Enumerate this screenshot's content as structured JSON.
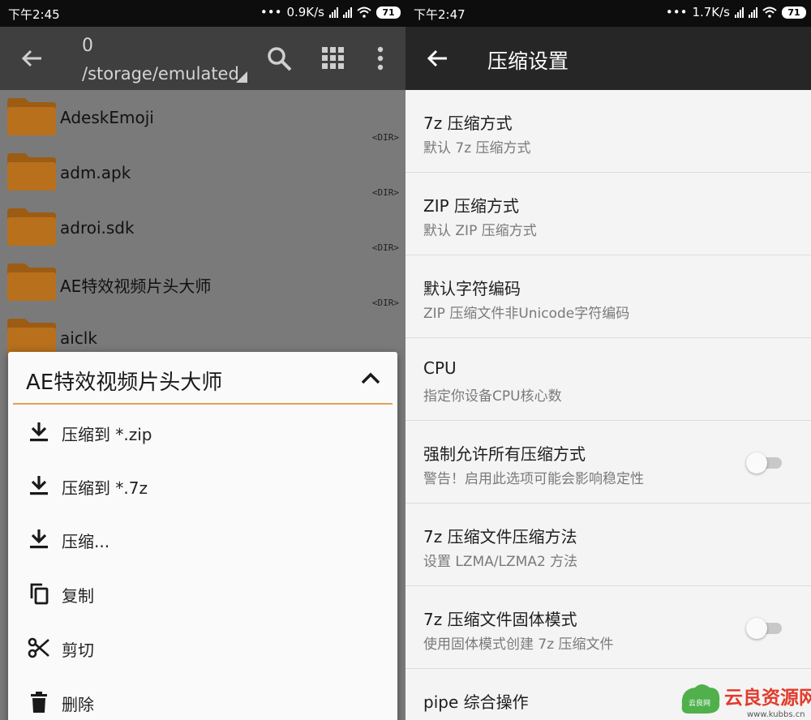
{
  "left": {
    "status": {
      "time": "下午2:45",
      "speed": "0.9K/s",
      "battery": "71"
    },
    "toolbar": {
      "count": "0",
      "path": "/storage/emulated"
    },
    "files": [
      {
        "name": "AdeskEmoji",
        "tag": "<DIR>"
      },
      {
        "name": "adm.apk",
        "tag": "<DIR>"
      },
      {
        "name": "adroi.sdk",
        "tag": "<DIR>"
      },
      {
        "name": "AE特效视频片头大师",
        "tag": "<DIR>"
      },
      {
        "name": "aiclk",
        "tag": ""
      }
    ],
    "menu": {
      "title": "AE特效视频片头大师",
      "items": [
        {
          "label": "压缩到 *.zip",
          "icon": "download-icon"
        },
        {
          "label": "压缩到 *.7z",
          "icon": "download-icon"
        },
        {
          "label": "压缩...",
          "icon": "download-icon"
        },
        {
          "label": "复制",
          "icon": "copy-icon"
        },
        {
          "label": "剪切",
          "icon": "scissors-icon"
        },
        {
          "label": "删除",
          "icon": "trash-icon"
        }
      ]
    }
  },
  "right": {
    "status": {
      "time": "下午2:47",
      "speed": "1.7K/s",
      "battery": "71"
    },
    "toolbar": {
      "title": "压缩设置"
    },
    "settings": [
      {
        "title": "7z 压缩方式",
        "subtitle": "默认 7z 压缩方式",
        "toggle": null
      },
      {
        "title": "ZIP 压缩方式",
        "subtitle": "默认 ZIP 压缩方式",
        "toggle": null
      },
      {
        "title": "默认字符编码",
        "subtitle": "ZIP 压缩文件非Unicode字符编码",
        "toggle": null
      },
      {
        "title": "CPU",
        "subtitle": "指定你设备CPU核心数",
        "toggle": null
      },
      {
        "title": "强制允许所有压缩方式",
        "subtitle": "警告！启用此选项可能会影响稳定性",
        "toggle": false
      },
      {
        "title": "7z 压缩文件压缩方法",
        "subtitle": "设置 LZMA/LZMA2 方法",
        "toggle": null
      },
      {
        "title": "7z 压缩文件固体模式",
        "subtitle": "使用固体模式创建 7z 压缩文件",
        "toggle": false
      },
      {
        "title": "pipe 综合操作",
        "subtitle": "",
        "toggle": null
      }
    ]
  },
  "watermark": {
    "text": "云良资源网",
    "small": "云良网",
    "url": "www.kubbs.cn"
  },
  "colors": {
    "folder": "#b8701c",
    "folder_tab": "#9c5c14",
    "accent": "#e3a24f",
    "toolbar_left": "#3f3f3f",
    "toolbar_right": "#262626"
  }
}
